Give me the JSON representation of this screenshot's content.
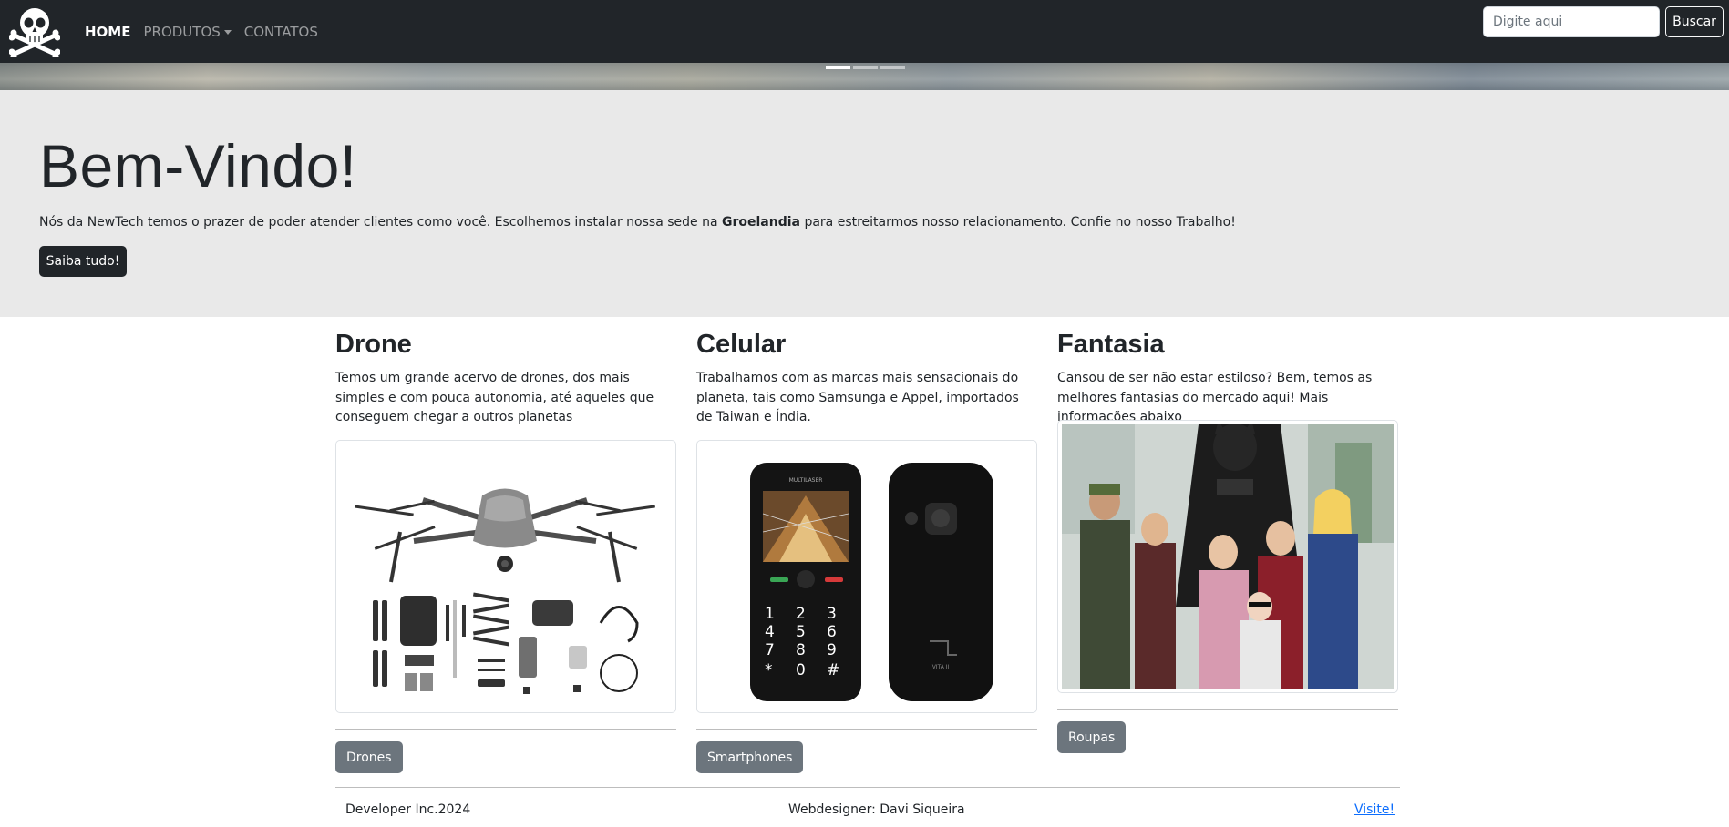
{
  "navbar": {
    "links": [
      {
        "label": "HOME"
      },
      {
        "label": "PRODUTOS"
      },
      {
        "label": "CONTATOS"
      }
    ],
    "search_placeholder": "Digite aqui",
    "search_button": "Buscar",
    "logo_icon": "skull-crossbones-icon"
  },
  "carousel": {
    "slides": 3,
    "active_slide": 1
  },
  "jumbotron": {
    "title": "Bem-Vindo!",
    "text_before": "Nós da NewTech temos o prazer de poder atender clientes como você. Escolhemos instalar nossa sede na ",
    "text_bold": "Groelandia",
    "text_after": " para estreitarmos nosso relacionamento. Confie no nosso Trabalho!",
    "button": "Saiba tudo!"
  },
  "products": [
    {
      "title": "Drone",
      "description": "Temos um grande acervo de drones, dos mais simples e com pouca autonomia, até aqueles que conseguem chegar a outros planetas",
      "button": "Drones",
      "image": "drone-image"
    },
    {
      "title": "Celular",
      "description": "Trabalhamos com as marcas mais sensacionais do planeta, tais como Samsunga e Appel, importados de Taiwan e Índia.",
      "button": "Smartphones",
      "image": "phone-image",
      "phone_brand": "MULTILASER",
      "phone_model": "VITA II"
    },
    {
      "title": "Fantasia",
      "description": "Cansou de ser não estar estiloso? Bem, temos as melhores fantasias do mercado aqui! Mais informações abaixo",
      "button": "Roupas",
      "image": "costume-image"
    }
  ],
  "footer": {
    "left": "Developer Inc.2024",
    "center": "Webdesigner: Davi Siqueira",
    "link": "Visite!"
  },
  "colors": {
    "navbar_bg": "#212529",
    "jumbotron_bg": "#e9e9e9",
    "secondary_button": "#6c757d",
    "link": "#0d6efd"
  }
}
